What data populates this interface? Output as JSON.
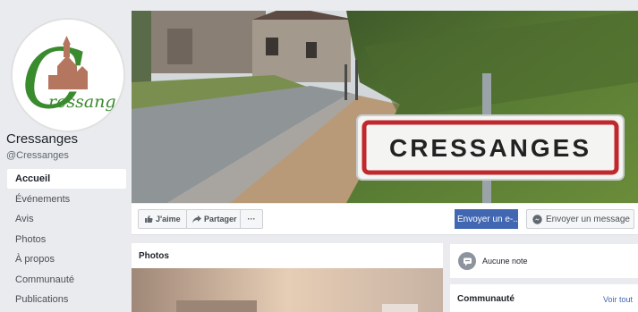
{
  "page": {
    "name": "Cressanges",
    "handle": "@Cressanges",
    "logo_text": "ressanges",
    "logo_initial": "C"
  },
  "nav": {
    "items": [
      {
        "label": "Accueil",
        "active": true
      },
      {
        "label": "Événements"
      },
      {
        "label": "Avis"
      },
      {
        "label": "Photos"
      },
      {
        "label": "À propos"
      },
      {
        "label": "Communauté"
      },
      {
        "label": "Publications"
      }
    ]
  },
  "cover": {
    "sign_text": "CRESSANGES"
  },
  "actions": {
    "like_label": "J'aime",
    "share_label": "Partager",
    "more_label": "···",
    "email_label": "Envoyer un e-...",
    "message_label": "Envoyer un message"
  },
  "photos": {
    "title": "Photos"
  },
  "rating": {
    "text": "Aucune note"
  },
  "community": {
    "title": "Communauté",
    "see_all": "Voir tout"
  },
  "colors": {
    "background": "#e9ebee",
    "brand_blue": "#4267b2",
    "logo_green": "#3a8a2e",
    "sign_red": "#c0282d"
  }
}
